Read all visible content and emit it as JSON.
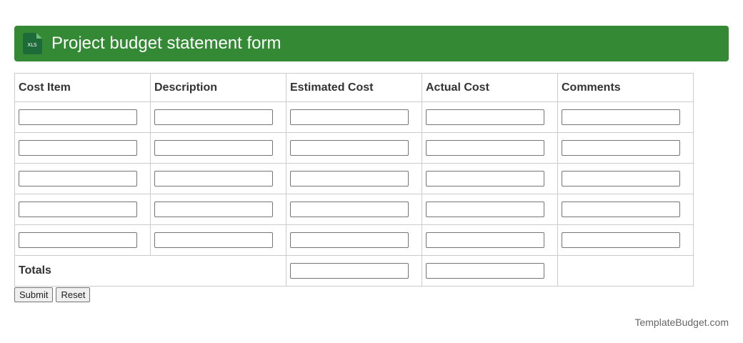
{
  "header": {
    "title": "Project budget statement form",
    "icon": {
      "name": "xls-file-icon",
      "text": "XLS",
      "color": "#1e6b3a"
    },
    "background": "#348a34"
  },
  "table": {
    "columns": [
      "Cost Item",
      "Description",
      "Estimated Cost",
      "Actual Cost",
      "Comments"
    ],
    "rows": [
      {
        "cost_item": "",
        "description": "",
        "estimated_cost": "",
        "actual_cost": "",
        "comments": ""
      },
      {
        "cost_item": "",
        "description": "",
        "estimated_cost": "",
        "actual_cost": "",
        "comments": ""
      },
      {
        "cost_item": "",
        "description": "",
        "estimated_cost": "",
        "actual_cost": "",
        "comments": ""
      },
      {
        "cost_item": "",
        "description": "",
        "estimated_cost": "",
        "actual_cost": "",
        "comments": ""
      },
      {
        "cost_item": "",
        "description": "",
        "estimated_cost": "",
        "actual_cost": "",
        "comments": ""
      }
    ],
    "totals": {
      "label": "Totals",
      "estimated_cost": "",
      "actual_cost": ""
    }
  },
  "buttons": {
    "submit": "Submit",
    "reset": "Reset"
  },
  "footer": {
    "brand": "TemplateBudget.com"
  }
}
